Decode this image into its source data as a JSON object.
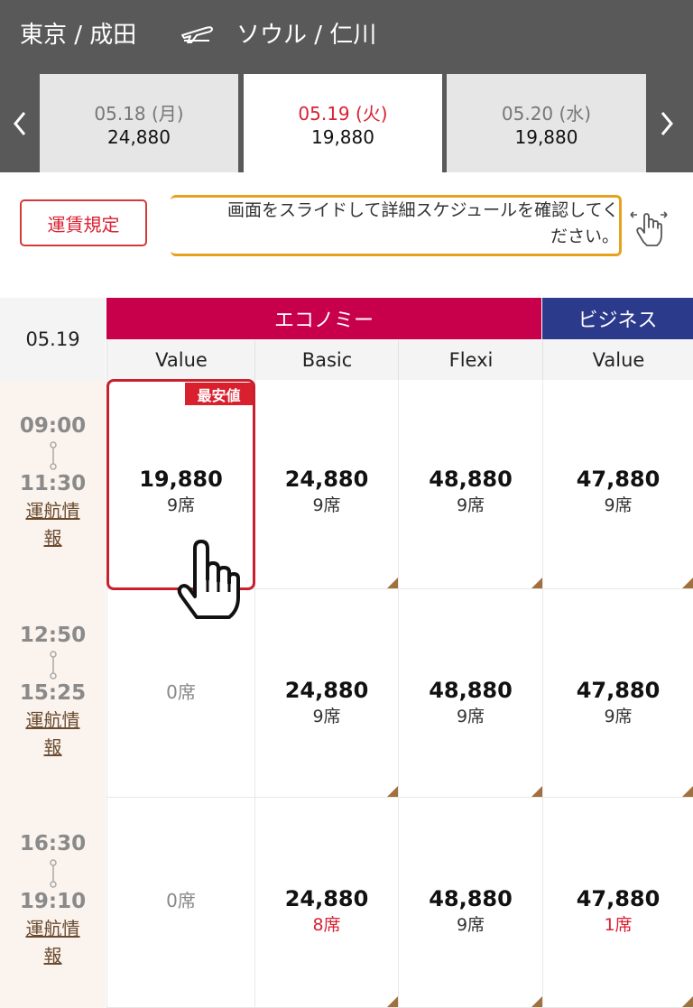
{
  "route": {
    "origin": "東京 / 成田",
    "destination": "ソウル / 仁川"
  },
  "date_tabs": [
    {
      "date": "05.18 (月)",
      "price": "24,880",
      "active": false
    },
    {
      "date": "05.19 (火)",
      "price": "19,880",
      "active": true
    },
    {
      "date": "05.20 (水)",
      "price": "19,880",
      "active": false
    }
  ],
  "fare_rules_label": "運賃規定",
  "hint_line1": "画面をスライドして詳細スケジュールを確認してく",
  "hint_line2": "ださい。",
  "table": {
    "date": "05.19",
    "economy_label": "エコノミー",
    "business_label": "ビジネス",
    "fare_headers": [
      "Value",
      "Basic",
      "Flexi",
      "Value"
    ],
    "cheapest_badge": "最安値",
    "flight_info_label": "運航情報",
    "flights": [
      {
        "dep": "09:00",
        "arr": "11:30",
        "fares": [
          {
            "price": "19,880",
            "seats": "9席"
          },
          {
            "price": "24,880",
            "seats": "9席"
          },
          {
            "price": "48,880",
            "seats": "9席"
          },
          {
            "price": "47,880",
            "seats": "9席"
          }
        ]
      },
      {
        "dep": "12:50",
        "arr": "15:25",
        "fares": [
          {
            "price": "",
            "seats": "0席"
          },
          {
            "price": "24,880",
            "seats": "9席"
          },
          {
            "price": "48,880",
            "seats": "9席"
          },
          {
            "price": "47,880",
            "seats": "9席"
          }
        ]
      },
      {
        "dep": "16:30",
        "arr": "19:10",
        "fares": [
          {
            "price": "",
            "seats": "0席"
          },
          {
            "price": "24,880",
            "seats": "8席"
          },
          {
            "price": "48,880",
            "seats": "9席"
          },
          {
            "price": "47,880",
            "seats": "1席"
          }
        ]
      }
    ]
  },
  "colors": {
    "economy": "#c8004b",
    "business": "#2c3a8c",
    "accent_red": "#d92233",
    "hint_border": "#e6a21f"
  }
}
